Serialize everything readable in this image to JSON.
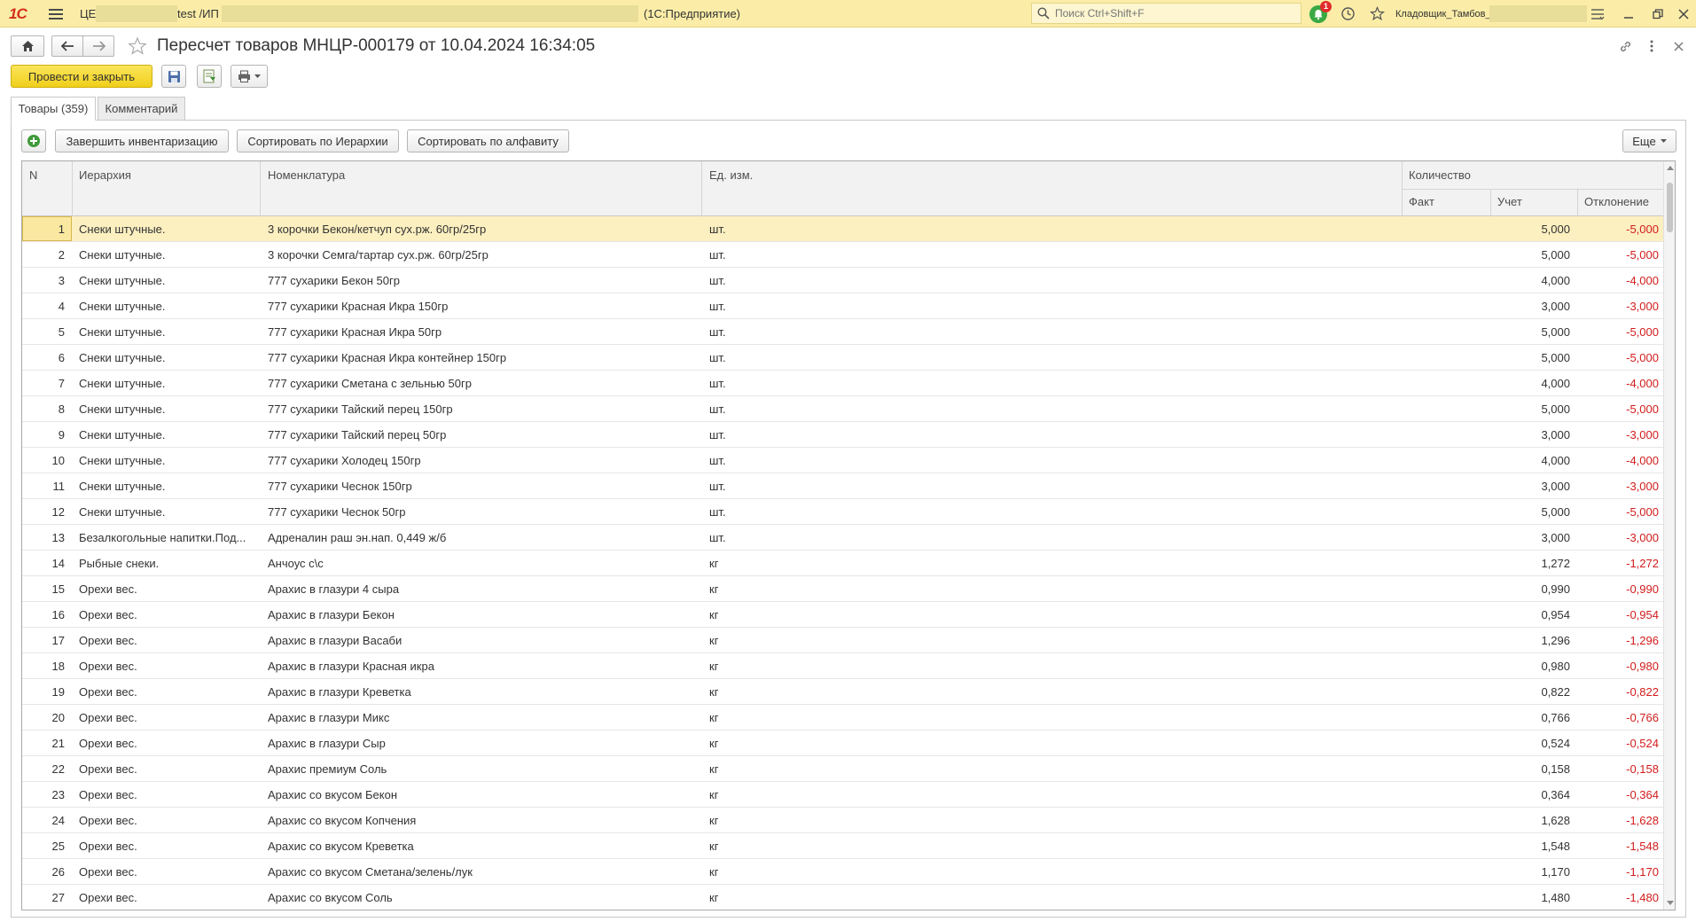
{
  "titlebar": {
    "logo": "1С",
    "prefix": "ЦЕ",
    "db_part": "test /ИП",
    "app_name": "(1С:Предприятие)",
    "search_placeholder": "Поиск Ctrl+Shift+F",
    "notification_count": "1",
    "user": "Кладовщик_Тамбов_"
  },
  "form": {
    "title": "Пересчет товаров МНЦР-000179 от 10.04.2024 16:34:05",
    "post_close_label": "Провести и закрыть"
  },
  "tabs": [
    {
      "label": "Товары (359)"
    },
    {
      "label": "Комментарий"
    }
  ],
  "toolbar": {
    "finish_label": "Завершить инвентаризацию",
    "sort_hierarchy_label": "Сортировать по Иерархии",
    "sort_alpha_label": "Сортировать по алфавиту",
    "more_label": "Еще"
  },
  "table": {
    "headers": {
      "n": "N",
      "hierarchy": "Иерархия",
      "item": "Номенклатура",
      "unit": "Ед. изм.",
      "quantity": "Количество",
      "fact": "Факт",
      "account": "Учет",
      "deviation": "Отклонение"
    },
    "rows": [
      {
        "n": "1",
        "hier": "Снеки штучные.",
        "item": "3 корочки Бекон/кетчуп сух.рж. 60гр/25гр",
        "unit": "шт.",
        "fact": "",
        "account": "5,000",
        "dev": "-5,000"
      },
      {
        "n": "2",
        "hier": "Снеки штучные.",
        "item": "3 корочки Семга/тартар сух.рж. 60гр/25гр",
        "unit": "шт.",
        "fact": "",
        "account": "5,000",
        "dev": "-5,000"
      },
      {
        "n": "3",
        "hier": "Снеки штучные.",
        "item": "777 сухарики Бекон 50гр",
        "unit": "шт.",
        "fact": "",
        "account": "4,000",
        "dev": "-4,000"
      },
      {
        "n": "4",
        "hier": "Снеки штучные.",
        "item": "777 сухарики Красная Икра 150гр",
        "unit": "шт.",
        "fact": "",
        "account": "3,000",
        "dev": "-3,000"
      },
      {
        "n": "5",
        "hier": "Снеки штучные.",
        "item": "777 сухарики Красная Икра 50гр",
        "unit": "шт.",
        "fact": "",
        "account": "5,000",
        "dev": "-5,000"
      },
      {
        "n": "6",
        "hier": "Снеки штучные.",
        "item": "777 сухарики Красная Икра контейнер 150гр",
        "unit": "шт.",
        "fact": "",
        "account": "5,000",
        "dev": "-5,000"
      },
      {
        "n": "7",
        "hier": "Снеки штучные.",
        "item": "777 сухарики Сметана с зельнью 50гр",
        "unit": "шт.",
        "fact": "",
        "account": "4,000",
        "dev": "-4,000"
      },
      {
        "n": "8",
        "hier": "Снеки штучные.",
        "item": "777 сухарики Тайский перец 150гр",
        "unit": "шт.",
        "fact": "",
        "account": "5,000",
        "dev": "-5,000"
      },
      {
        "n": "9",
        "hier": "Снеки штучные.",
        "item": "777 сухарики Тайский перец 50гр",
        "unit": "шт.",
        "fact": "",
        "account": "3,000",
        "dev": "-3,000"
      },
      {
        "n": "10",
        "hier": "Снеки штучные.",
        "item": "777 сухарики Холодец 150гр",
        "unit": "шт.",
        "fact": "",
        "account": "4,000",
        "dev": "-4,000"
      },
      {
        "n": "11",
        "hier": "Снеки штучные.",
        "item": "777 сухарики Чеснок 150гр",
        "unit": "шт.",
        "fact": "",
        "account": "3,000",
        "dev": "-3,000"
      },
      {
        "n": "12",
        "hier": "Снеки штучные.",
        "item": "777 сухарики Чеснок 50гр",
        "unit": "шт.",
        "fact": "",
        "account": "5,000",
        "dev": "-5,000"
      },
      {
        "n": "13",
        "hier": "Безалкогольные напитки.Под...",
        "item": "Адреналин раш эн.нап. 0,449 ж/б",
        "unit": "шт.",
        "fact": "",
        "account": "3,000",
        "dev": "-3,000"
      },
      {
        "n": "14",
        "hier": "Рыбные снеки.",
        "item": "Анчоус с\\с",
        "unit": "кг",
        "fact": "",
        "account": "1,272",
        "dev": "-1,272"
      },
      {
        "n": "15",
        "hier": "Орехи вес.",
        "item": "Арахис в глазури 4 сыра",
        "unit": "кг",
        "fact": "",
        "account": "0,990",
        "dev": "-0,990"
      },
      {
        "n": "16",
        "hier": "Орехи вес.",
        "item": "Арахис в глазури Бекон",
        "unit": "кг",
        "fact": "",
        "account": "0,954",
        "dev": "-0,954"
      },
      {
        "n": "17",
        "hier": "Орехи вес.",
        "item": "Арахис в глазури Васаби",
        "unit": "кг",
        "fact": "",
        "account": "1,296",
        "dev": "-1,296"
      },
      {
        "n": "18",
        "hier": "Орехи вес.",
        "item": "Арахис в глазури Красная икра",
        "unit": "кг",
        "fact": "",
        "account": "0,980",
        "dev": "-0,980"
      },
      {
        "n": "19",
        "hier": "Орехи вес.",
        "item": "Арахис в глазури Креветка",
        "unit": "кг",
        "fact": "",
        "account": "0,822",
        "dev": "-0,822"
      },
      {
        "n": "20",
        "hier": "Орехи вес.",
        "item": "Арахис в глазури Микс",
        "unit": "кг",
        "fact": "",
        "account": "0,766",
        "dev": "-0,766"
      },
      {
        "n": "21",
        "hier": "Орехи вес.",
        "item": "Арахис в глазури Сыр",
        "unit": "кг",
        "fact": "",
        "account": "0,524",
        "dev": "-0,524"
      },
      {
        "n": "22",
        "hier": "Орехи вес.",
        "item": "Арахис премиум Соль",
        "unit": "кг",
        "fact": "",
        "account": "0,158",
        "dev": "-0,158"
      },
      {
        "n": "23",
        "hier": "Орехи вес.",
        "item": "Арахис со вкусом Бекон",
        "unit": "кг",
        "fact": "",
        "account": "0,364",
        "dev": "-0,364"
      },
      {
        "n": "24",
        "hier": "Орехи вес.",
        "item": "Арахис со вкусом Копчения",
        "unit": "кг",
        "fact": "",
        "account": "1,628",
        "dev": "-1,628"
      },
      {
        "n": "25",
        "hier": "Орехи вес.",
        "item": "Арахис со вкусом Креветка",
        "unit": "кг",
        "fact": "",
        "account": "1,548",
        "dev": "-1,548"
      },
      {
        "n": "26",
        "hier": "Орехи вес.",
        "item": "Арахис со вкусом Сметана/зелень/лук",
        "unit": "кг",
        "fact": "",
        "account": "1,170",
        "dev": "-1,170"
      },
      {
        "n": "27",
        "hier": "Орехи вес.",
        "item": "Арахис со вкусом Соль",
        "unit": "кг",
        "fact": "",
        "account": "1,480",
        "dev": "-1,480"
      }
    ]
  },
  "colors": {
    "titlebar_bg": "#fbeda8",
    "primary_button": "#f0cf1a",
    "selected_row": "#fcefc0",
    "negative_text": "#d21c1c"
  },
  "icons": {
    "home": "home-icon",
    "back": "arrow-left-icon",
    "forward": "arrow-right-icon",
    "favorite": "star-icon",
    "save": "floppy-disk-icon",
    "report": "document-report-icon",
    "print": "printer-icon",
    "add": "plus-circle-icon",
    "link": "link-icon",
    "more": "more-vertical-icon",
    "close": "close-icon"
  }
}
